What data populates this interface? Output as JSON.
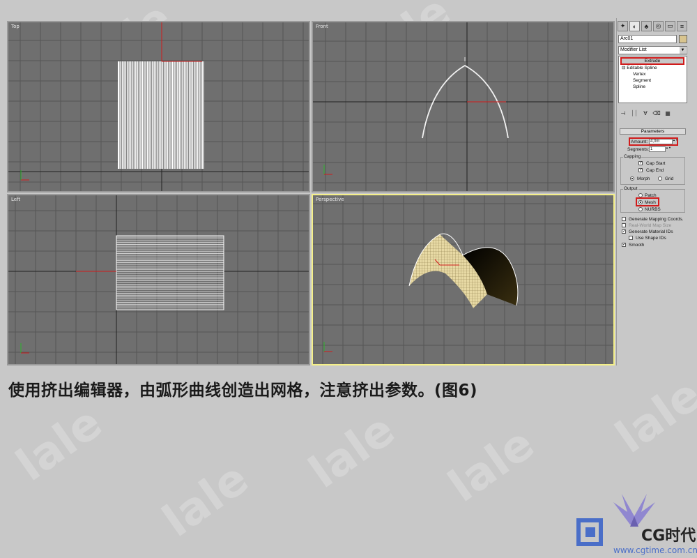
{
  "viewports": {
    "top": {
      "label": "Top"
    },
    "front": {
      "label": "Front"
    },
    "left": {
      "label": "Left"
    },
    "perspective": {
      "label": "Perspective"
    }
  },
  "toolbar": {
    "tabs": [
      "create-icon",
      "modify-icon",
      "hierarchy-icon",
      "motion-icon",
      "display-icon",
      "utilities-icon"
    ]
  },
  "object": {
    "name": "Arc01",
    "color": "#d8c48e"
  },
  "modifier_list": {
    "label": "Modifier List"
  },
  "stack": {
    "items": [
      {
        "label": "Extrude",
        "selected": true
      },
      {
        "label": "Editable Spline"
      },
      {
        "label": "Vertex"
      },
      {
        "label": "Segment"
      },
      {
        "label": "Spline"
      }
    ]
  },
  "parameters": {
    "title": "Parameters",
    "amount_label": "Amount:",
    "amount_value": "4,0m",
    "segments_label": "Segments:",
    "segments_value": "1",
    "capping_title": "Capping",
    "cap_start": "Cap Start",
    "cap_end": "Cap End",
    "morph": "Morph",
    "grid": "Grid",
    "output_title": "Output",
    "patch": "Patch",
    "mesh": "Mesh",
    "nurbs": "NURBS",
    "gen_mapping": "Generate Mapping Coords.",
    "real_world": "Real-World Map Size",
    "gen_material": "Generate Material IDs",
    "use_shape": "Use Shape IDs",
    "smooth": "Smooth"
  },
  "caption": "使用挤出编辑器，由弧形曲线创造出网格，注意挤出参数。(图6)",
  "watermark": "lale",
  "logo": {
    "brand": "CG时代",
    "url": "www.cgtime.com.cn"
  },
  "colors": {
    "highlight": "#d11b1b",
    "active_viewport": "#f4ef8a",
    "viewport_bg": "#6f6f6f"
  }
}
